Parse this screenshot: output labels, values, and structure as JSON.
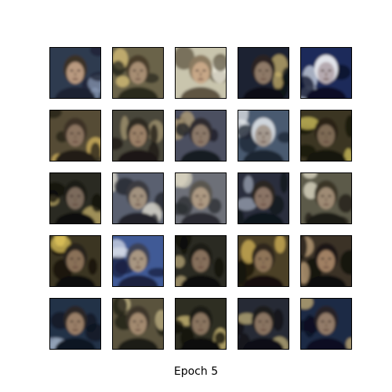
{
  "caption": "Epoch 5",
  "grid": {
    "rows": 5,
    "cols": 5,
    "tiles": [
      {
        "bg": "#2e3a4f",
        "accent": "#8a9bb5",
        "face": "#b99a80",
        "hair": "#3a3128",
        "dark": "#1c2233"
      },
      {
        "bg": "#6b6448",
        "accent": "#d9c27a",
        "face": "#a78e73",
        "hair": "#4a3e2c",
        "dark": "#2b2a1f"
      },
      {
        "bg": "#c9c5ad",
        "accent": "#f2efe2",
        "face": "#c8a888",
        "hair": "#8b7a60",
        "dark": "#5e5442"
      },
      {
        "bg": "#1d2330",
        "accent": "#c9b36d",
        "face": "#8f7a68",
        "hair": "#2a2420",
        "dark": "#0e1118"
      },
      {
        "bg": "#1b2a5a",
        "accent": "#d8e0ef",
        "face": "#b6aab0",
        "hair": "#e2e4ea",
        "dark": "#0b1026"
      },
      {
        "bg": "#544b35",
        "accent": "#d9b85f",
        "face": "#8c7560",
        "hair": "#3e3326",
        "dark": "#221d15"
      },
      {
        "bg": "#4a463a",
        "accent": "#a89a74",
        "face": "#9b8168",
        "hair": "#2e2a24",
        "dark": "#1a1814"
      },
      {
        "bg": "#4c5060",
        "accent": "#b7a37a",
        "face": "#8d7a6a",
        "hair": "#2d2b2f",
        "dark": "#181a22"
      },
      {
        "bg": "#4a5a70",
        "accent": "#e4e7ea",
        "face": "#a59a90",
        "hair": "#cfd5dc",
        "dark": "#1e2533"
      },
      {
        "bg": "#3a3622",
        "accent": "#d2c25c",
        "face": "#7e6a55",
        "hair": "#2a2418",
        "dark": "#14120c"
      },
      {
        "bg": "#2b2b22",
        "accent": "#c7b26c",
        "face": "#7c6b5c",
        "hair": "#1e1c18",
        "dark": "#0c0c0a"
      },
      {
        "bg": "#5a6070",
        "accent": "#e8e4d6",
        "face": "#a2927f",
        "hair": "#3a3a40",
        "dark": "#20222a"
      },
      {
        "bg": "#6d7078",
        "accent": "#d9d4c0",
        "face": "#ad9a83",
        "hair": "#5a5650",
        "dark": "#2a2c30"
      },
      {
        "bg": "#2a2f3c",
        "accent": "#9ea6b6",
        "face": "#8b7566",
        "hair": "#2b2522",
        "dark": "#11141c"
      },
      {
        "bg": "#5c5a48",
        "accent": "#e6e2cc",
        "face": "#9f8b74",
        "hair": "#3a3528",
        "dark": "#1e1c16"
      },
      {
        "bg": "#3b3620",
        "accent": "#e0c45a",
        "face": "#8a7158",
        "hair": "#27211a",
        "dark": "#100e0a"
      },
      {
        "bg": "#3f5a96",
        "accent": "#d7dce8",
        "face": "#a99782",
        "hair": "#3c4256",
        "dark": "#1a2240"
      },
      {
        "bg": "#2a2a24",
        "accent": "#b9a878",
        "face": "#86705c",
        "hair": "#1e1b17",
        "dark": "#0c0b09"
      },
      {
        "bg": "#4b4126",
        "accent": "#d6b65a",
        "face": "#8f7558",
        "hair": "#2f271b",
        "dark": "#14110b"
      },
      {
        "bg": "#3b3128",
        "accent": "#c4a57d",
        "face": "#a08063",
        "hair": "#1b1714",
        "dark": "#0e0c0a"
      },
      {
        "bg": "#233047",
        "accent": "#9aa8bd",
        "face": "#9a7f68",
        "hair": "#2b2825",
        "dark": "#0e1320"
      },
      {
        "bg": "#5a533e",
        "accent": "#cdbf8e",
        "face": "#a38a70",
        "hair": "#3c352a",
        "dark": "#1e1b15"
      },
      {
        "bg": "#2e2e24",
        "accent": "#d5c27a",
        "face": "#8b7660",
        "hair": "#1d1c17",
        "dark": "#0b0b08"
      },
      {
        "bg": "#262b34",
        "accent": "#c0b07a",
        "face": "#8a7562",
        "hair": "#1f1d1c",
        "dark": "#0d0f14"
      },
      {
        "bg": "#1f2a44",
        "accent": "#c8b278",
        "face": "#937c69",
        "hair": "#262426",
        "dark": "#0c1020"
      }
    ]
  }
}
